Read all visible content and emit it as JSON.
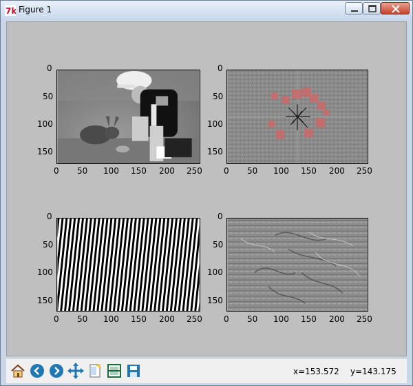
{
  "window": {
    "title": "Figure 1"
  },
  "axes": {
    "top_left": {
      "y_ticks": [
        "0",
        "50",
        "100",
        "150"
      ],
      "x_ticks": [
        "0",
        "50",
        "100",
        "150",
        "200",
        "250"
      ]
    },
    "top_right": {
      "y_ticks": [
        "0",
        "50",
        "100",
        "150"
      ],
      "x_ticks": [
        "0",
        "50",
        "100",
        "150",
        "200",
        "250"
      ]
    },
    "bottom_left": {
      "y_ticks": [
        "0",
        "50",
        "100",
        "150"
      ],
      "x_ticks": [
        "0",
        "50",
        "100",
        "150",
        "200",
        "250"
      ]
    },
    "bottom_right": {
      "y_ticks": [
        "0",
        "50",
        "100",
        "150"
      ],
      "x_ticks": [
        "0",
        "50",
        "100",
        "150",
        "200",
        "250"
      ]
    }
  },
  "toolbar": {
    "buttons": [
      "home-icon",
      "back-icon",
      "forward-icon",
      "pan-icon",
      "zoom-icon",
      "configure-subplots-icon",
      "save-icon"
    ]
  },
  "status": {
    "x_readout": "x=153.572",
    "y_readout": "y=143.175"
  }
}
